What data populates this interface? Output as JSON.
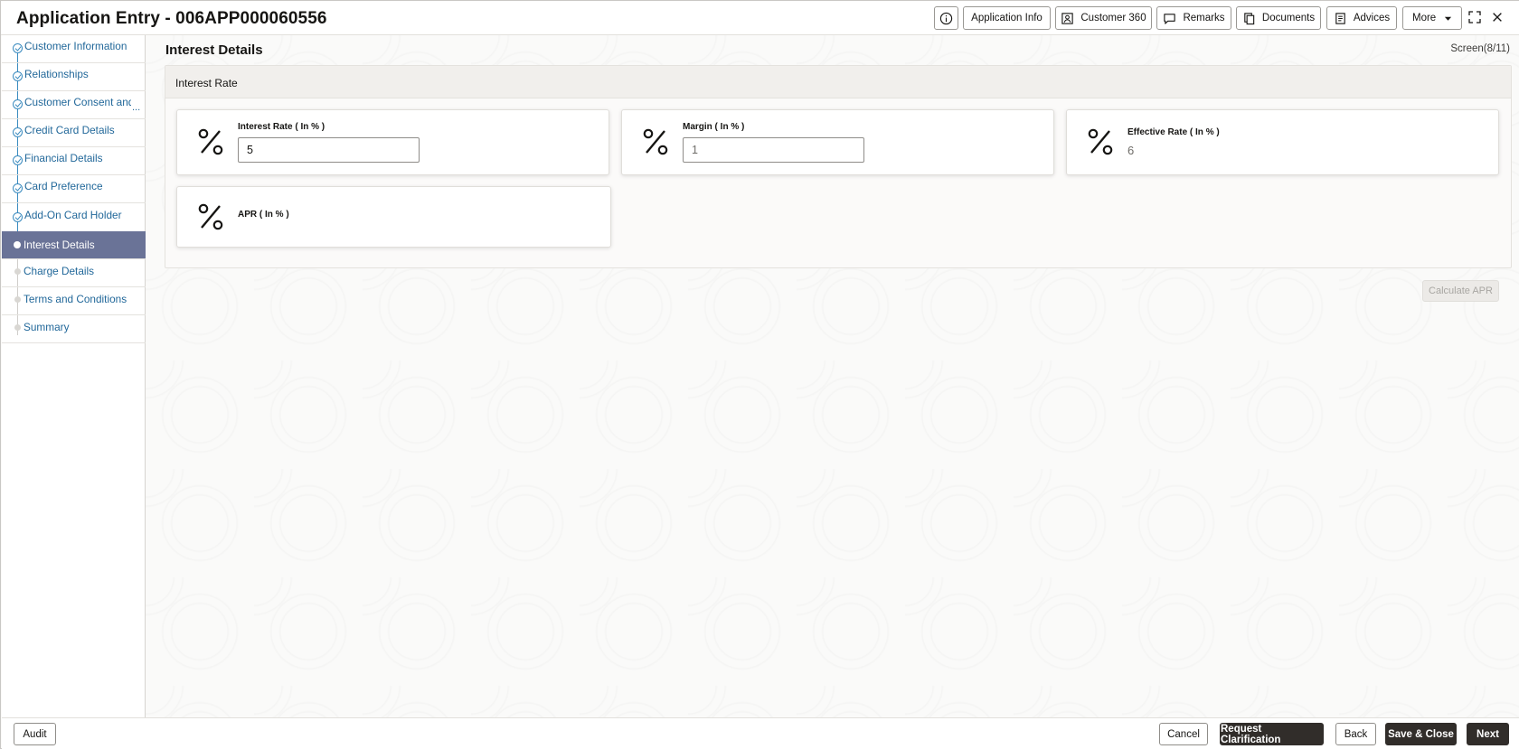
{
  "header": {
    "title": "Application Entry - 006APP000060556",
    "buttons": {
      "application_info": "Application Info",
      "customer_360": "Customer 360",
      "remarks": "Remarks",
      "documents": "Documents",
      "advices": "Advices",
      "more": "More"
    }
  },
  "sidebar": {
    "items": [
      {
        "label": "Customer Information",
        "state": "done"
      },
      {
        "label": "Relationships",
        "state": "done"
      },
      {
        "label": "Customer Consent and",
        "state": "done"
      },
      {
        "label": "Credit Card Details",
        "state": "done"
      },
      {
        "label": "Financial Details",
        "state": "done"
      },
      {
        "label": "Card Preference",
        "state": "done"
      },
      {
        "label": "Add-On Card Holder",
        "state": "done"
      },
      {
        "label": "Interest Details",
        "state": "active"
      },
      {
        "label": "Charge Details",
        "state": "pending"
      },
      {
        "label": "Terms and Conditions",
        "state": "pending"
      },
      {
        "label": "Summary",
        "state": "pending"
      }
    ],
    "overflow_marker": "..."
  },
  "main": {
    "page_title": "Interest Details",
    "screen_indicator": "Screen(8/11)",
    "section_title": "Interest Rate",
    "fields": {
      "interest_rate": {
        "label": "Interest Rate ( In % )",
        "value": "5"
      },
      "margin": {
        "label": "Margin ( In % )",
        "value": "1"
      },
      "effective_rate": {
        "label": "Effective Rate ( In % )",
        "value": "6"
      },
      "apr": {
        "label": "APR ( In % )",
        "value": ""
      }
    },
    "calculate_apr": "Calculate APR"
  },
  "footer": {
    "audit": "Audit",
    "cancel": "Cancel",
    "request_clarification": "Request Clarification",
    "back": "Back",
    "save_close": "Save & Close",
    "next": "Next"
  },
  "colors": {
    "active_nav_bg": "#6a7397",
    "link_blue": "#22689a",
    "primary_button": "#312d2a"
  }
}
